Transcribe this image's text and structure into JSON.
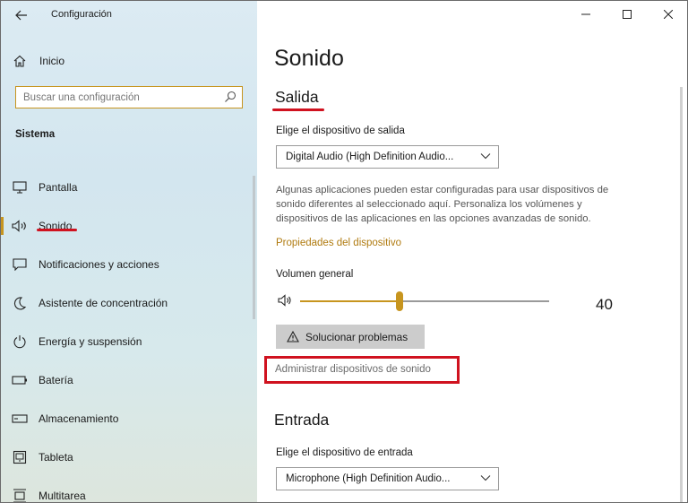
{
  "window": {
    "title": "Configuración"
  },
  "sidebar": {
    "home_label": "Inicio",
    "search_placeholder": "Buscar una configuración",
    "section_title": "Sistema",
    "items": [
      {
        "label": "Pantalla",
        "icon": "monitor-icon"
      },
      {
        "label": "Sonido",
        "icon": "speaker-icon",
        "active": true
      },
      {
        "label": "Notificaciones y acciones",
        "icon": "notification-icon"
      },
      {
        "label": "Asistente de concentración",
        "icon": "moon-icon"
      },
      {
        "label": "Energía y suspensión",
        "icon": "power-icon"
      },
      {
        "label": "Batería",
        "icon": "battery-icon"
      },
      {
        "label": "Almacenamiento",
        "icon": "storage-icon"
      },
      {
        "label": "Tableta",
        "icon": "tablet-icon"
      },
      {
        "label": "Multitarea",
        "icon": "multitask-icon"
      }
    ]
  },
  "main": {
    "page_title": "Sonido",
    "output": {
      "heading": "Salida",
      "device_label": "Elige el dispositivo de salida",
      "device_value": "Digital Audio (High Definition Audio...",
      "description": "Algunas aplicaciones pueden estar configuradas para usar dispositivos de sonido diferentes al seleccionado aquí. Personaliza los volúmenes y dispositivos de las aplicaciones en las opciones avanzadas de sonido.",
      "properties_link": "Propiedades del dispositivo",
      "volume_label": "Volumen general",
      "volume_value": "40",
      "volume_level": 40,
      "troubleshoot_label": "Solucionar problemas",
      "manage_link": "Administrar dispositivos de sonido"
    },
    "input": {
      "heading": "Entrada",
      "device_label": "Elige el dispositivo de entrada",
      "device_value": "Microphone (High Definition Audio..."
    }
  },
  "colors": {
    "accent": "#c7951f",
    "highlight": "#d0121f",
    "link": "#b07b10"
  }
}
